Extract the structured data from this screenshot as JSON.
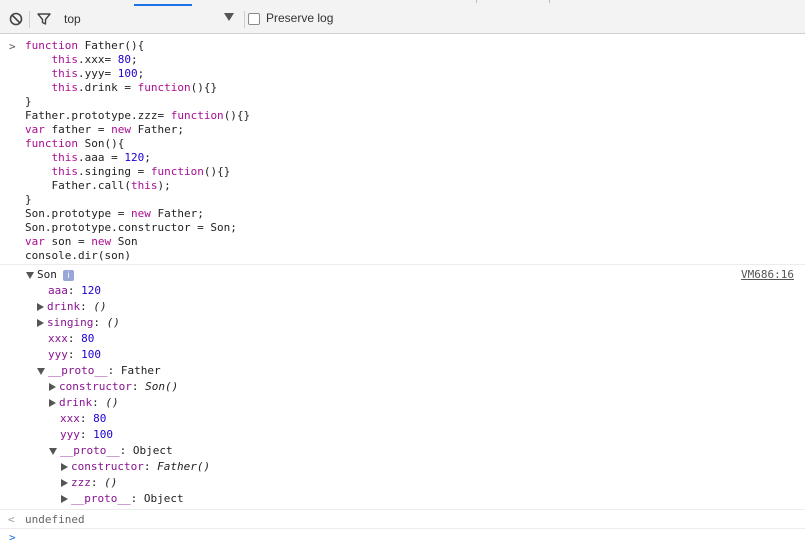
{
  "toolbar": {
    "context": "top",
    "preserve_log_label": "Preserve log",
    "preserve_log_checked": false
  },
  "console": {
    "input_prompt": ">",
    "code": [
      "function Father(){",
      "    this.xxx= 80;",
      "    this.yyy= 100;",
      "    this.drink = function(){}",
      "}",
      "Father.prototype.zzz= function(){}",
      "var father = new Father;",
      "function Son(){",
      "    this.aaa = 120;",
      "    this.singing = function(){}",
      "    Father.call(this);",
      "}",
      "Son.prototype = new Father;",
      "Son.prototype.constructor = Son;",
      "var son = new Son",
      "console.dir(son)"
    ],
    "output": {
      "root_label": "Son",
      "info_icon": "i",
      "source": "VM686:16",
      "aaa": {
        "key": "aaa",
        "value": "120"
      },
      "drink": {
        "key": "drink",
        "value": "()"
      },
      "singing": {
        "key": "singing",
        "value": "()"
      },
      "xxx": {
        "key": "xxx",
        "value": "80"
      },
      "yyy": {
        "key": "yyy",
        "value": "100"
      },
      "proto1": {
        "key": "__proto__",
        "value": "Father"
      },
      "proto1_constructor": {
        "key": "constructor",
        "value": "Son()"
      },
      "proto1_drink": {
        "key": "drink",
        "value": "()"
      },
      "proto1_xxx": {
        "key": "xxx",
        "value": "80"
      },
      "proto1_yyy": {
        "key": "yyy",
        "value": "100"
      },
      "proto2": {
        "key": "__proto__",
        "value": "Object"
      },
      "proto2_constructor": {
        "key": "constructor",
        "value": "Father()"
      },
      "proto2_zzz": {
        "key": "zzz",
        "value": "()"
      },
      "proto3": {
        "key": "__proto__",
        "value": "Object"
      }
    },
    "result_prompt": "<",
    "result": "undefined",
    "final_prompt": ">"
  },
  "icons": {
    "clear": "clear-console-icon",
    "filter": "filter-icon",
    "dropdown": "chevron-down-icon"
  }
}
